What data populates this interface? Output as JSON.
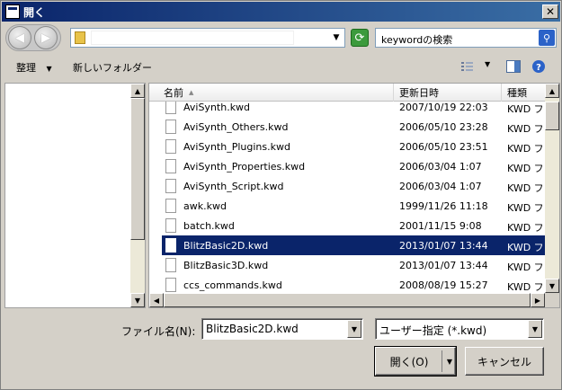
{
  "window": {
    "title": "開く",
    "close_glyph": "✕"
  },
  "address": {
    "path": "",
    "search_placeholder": "keywordの検索"
  },
  "toolbar": {
    "organize_label": "整理",
    "new_folder_label": "新しいフォルダー"
  },
  "columns": {
    "name": "名前",
    "date": "更新日時",
    "type": "種類"
  },
  "files": [
    {
      "name": "AviSynth.kwd",
      "date": "2007/10/19 22:03",
      "type": "KWD ファ"
    },
    {
      "name": "AviSynth_Others.kwd",
      "date": "2006/05/10 23:28",
      "type": "KWD ファ"
    },
    {
      "name": "AviSynth_Plugins.kwd",
      "date": "2006/05/10 23:51",
      "type": "KWD ファ"
    },
    {
      "name": "AviSynth_Properties.kwd",
      "date": "2006/03/04 1:07",
      "type": "KWD ファ"
    },
    {
      "name": "AviSynth_Script.kwd",
      "date": "2006/03/04 1:07",
      "type": "KWD ファ"
    },
    {
      "name": "awk.kwd",
      "date": "1999/11/26 11:18",
      "type": "KWD ファ"
    },
    {
      "name": "batch.kwd",
      "date": "2001/11/15 9:08",
      "type": "KWD ファ"
    },
    {
      "name": "BlitzBasic2D.kwd",
      "date": "2013/01/07 13:44",
      "type": "KWD ファ",
      "selected": true
    },
    {
      "name": "BlitzBasic3D.kwd",
      "date": "2013/01/07 13:44",
      "type": "KWD ファ"
    },
    {
      "name": "ccs_commands.kwd",
      "date": "2008/08/19 15:27",
      "type": "KWD ファ"
    }
  ],
  "footer": {
    "filename_label": "ファイル名(N):",
    "filename_value": "BlitzBasic2D.kwd",
    "filter_value": "ユーザー指定 (*.kwd)",
    "open_label": "開く(O)",
    "cancel_label": "キャンセル"
  }
}
